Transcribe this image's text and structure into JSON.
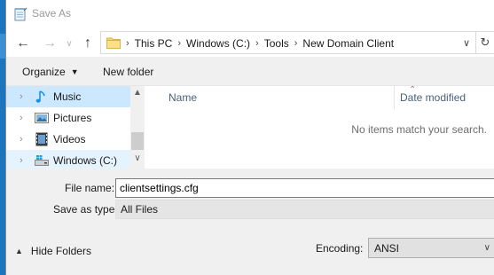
{
  "window": {
    "title": "Save As"
  },
  "nav": {
    "back_icon": "back-arrow-icon",
    "forward_icon": "forward-arrow-icon",
    "up_icon": "up-arrow-icon",
    "breadcrumbs": [
      "This PC",
      "Windows (C:)",
      "Tools",
      "New Domain Client"
    ],
    "separator": "›"
  },
  "commands": {
    "organize": "Organize",
    "new_folder": "New folder"
  },
  "tree": {
    "items": [
      {
        "label": "Music",
        "icon": "music-icon"
      },
      {
        "label": "Pictures",
        "icon": "pictures-icon"
      },
      {
        "label": "Videos",
        "icon": "videos-icon"
      },
      {
        "label": "Windows (C:)",
        "icon": "drive-icon"
      }
    ]
  },
  "files": {
    "columns": [
      "Name",
      "Date modified"
    ],
    "empty_message": "No items match your search."
  },
  "form": {
    "filename_label": "File name:",
    "filename_value": "clientsettings.cfg",
    "savetype_label": "Save as type:",
    "savetype_value": "All Files",
    "hide_folders_label": "Hide Folders",
    "encoding_label": "Encoding:",
    "encoding_value": "ANSI"
  },
  "colors": {
    "selected_row": "#cce8ff",
    "hover_row": "#e5f3ff",
    "accent_blue": "#1c75bc",
    "header_text": "#4c607a"
  }
}
